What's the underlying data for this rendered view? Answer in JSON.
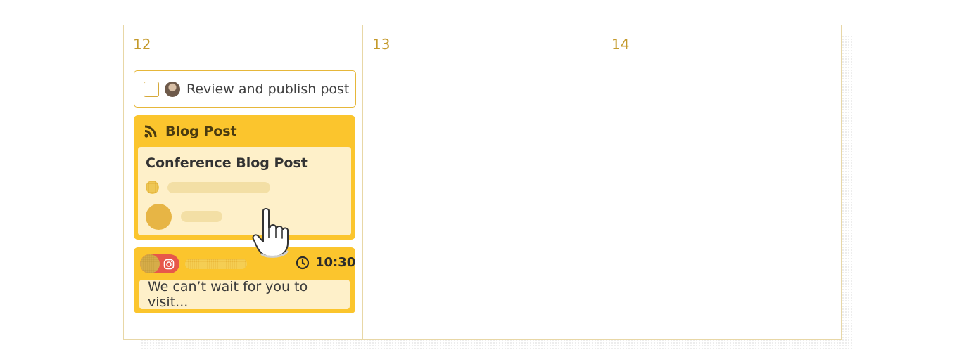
{
  "calendar": {
    "days": [
      {
        "number": "12"
      },
      {
        "number": "13"
      },
      {
        "number": "14"
      }
    ]
  },
  "task": {
    "title": "Review and publish post",
    "checked": false
  },
  "blog_card": {
    "type_label": "Blog Post",
    "title": "Conference Blog Post",
    "icon": "rss-icon"
  },
  "social_card": {
    "platform_icon": "instagram-icon",
    "time": "10:30",
    "preview_text": "We can’t wait for you to visit..."
  },
  "colors": {
    "accent_yellow": "#fbc52d",
    "card_inner": "#fef0c9",
    "day_number": "#c49a2c",
    "instagram_pill": "#e7584a"
  }
}
